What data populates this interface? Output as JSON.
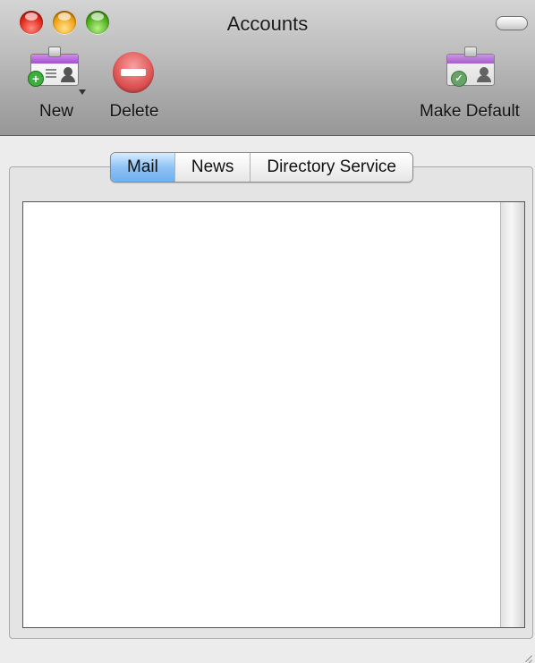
{
  "window": {
    "title": "Accounts"
  },
  "toolbar": {
    "new_label": "New",
    "delete_label": "Delete",
    "make_default_label": "Make Default"
  },
  "tabs": [
    {
      "label": "Mail",
      "active": true
    },
    {
      "label": "News",
      "active": false
    },
    {
      "label": "Directory Service",
      "active": false
    }
  ],
  "icons": {
    "new": "add-account-card-icon",
    "delete": "delete-no-entry-icon",
    "make_default": "default-account-card-icon"
  },
  "colors": {
    "active_tab": "#8fc2f4",
    "close": "#e0281a",
    "minimize": "#f0a012",
    "zoom": "#4fae1c"
  }
}
